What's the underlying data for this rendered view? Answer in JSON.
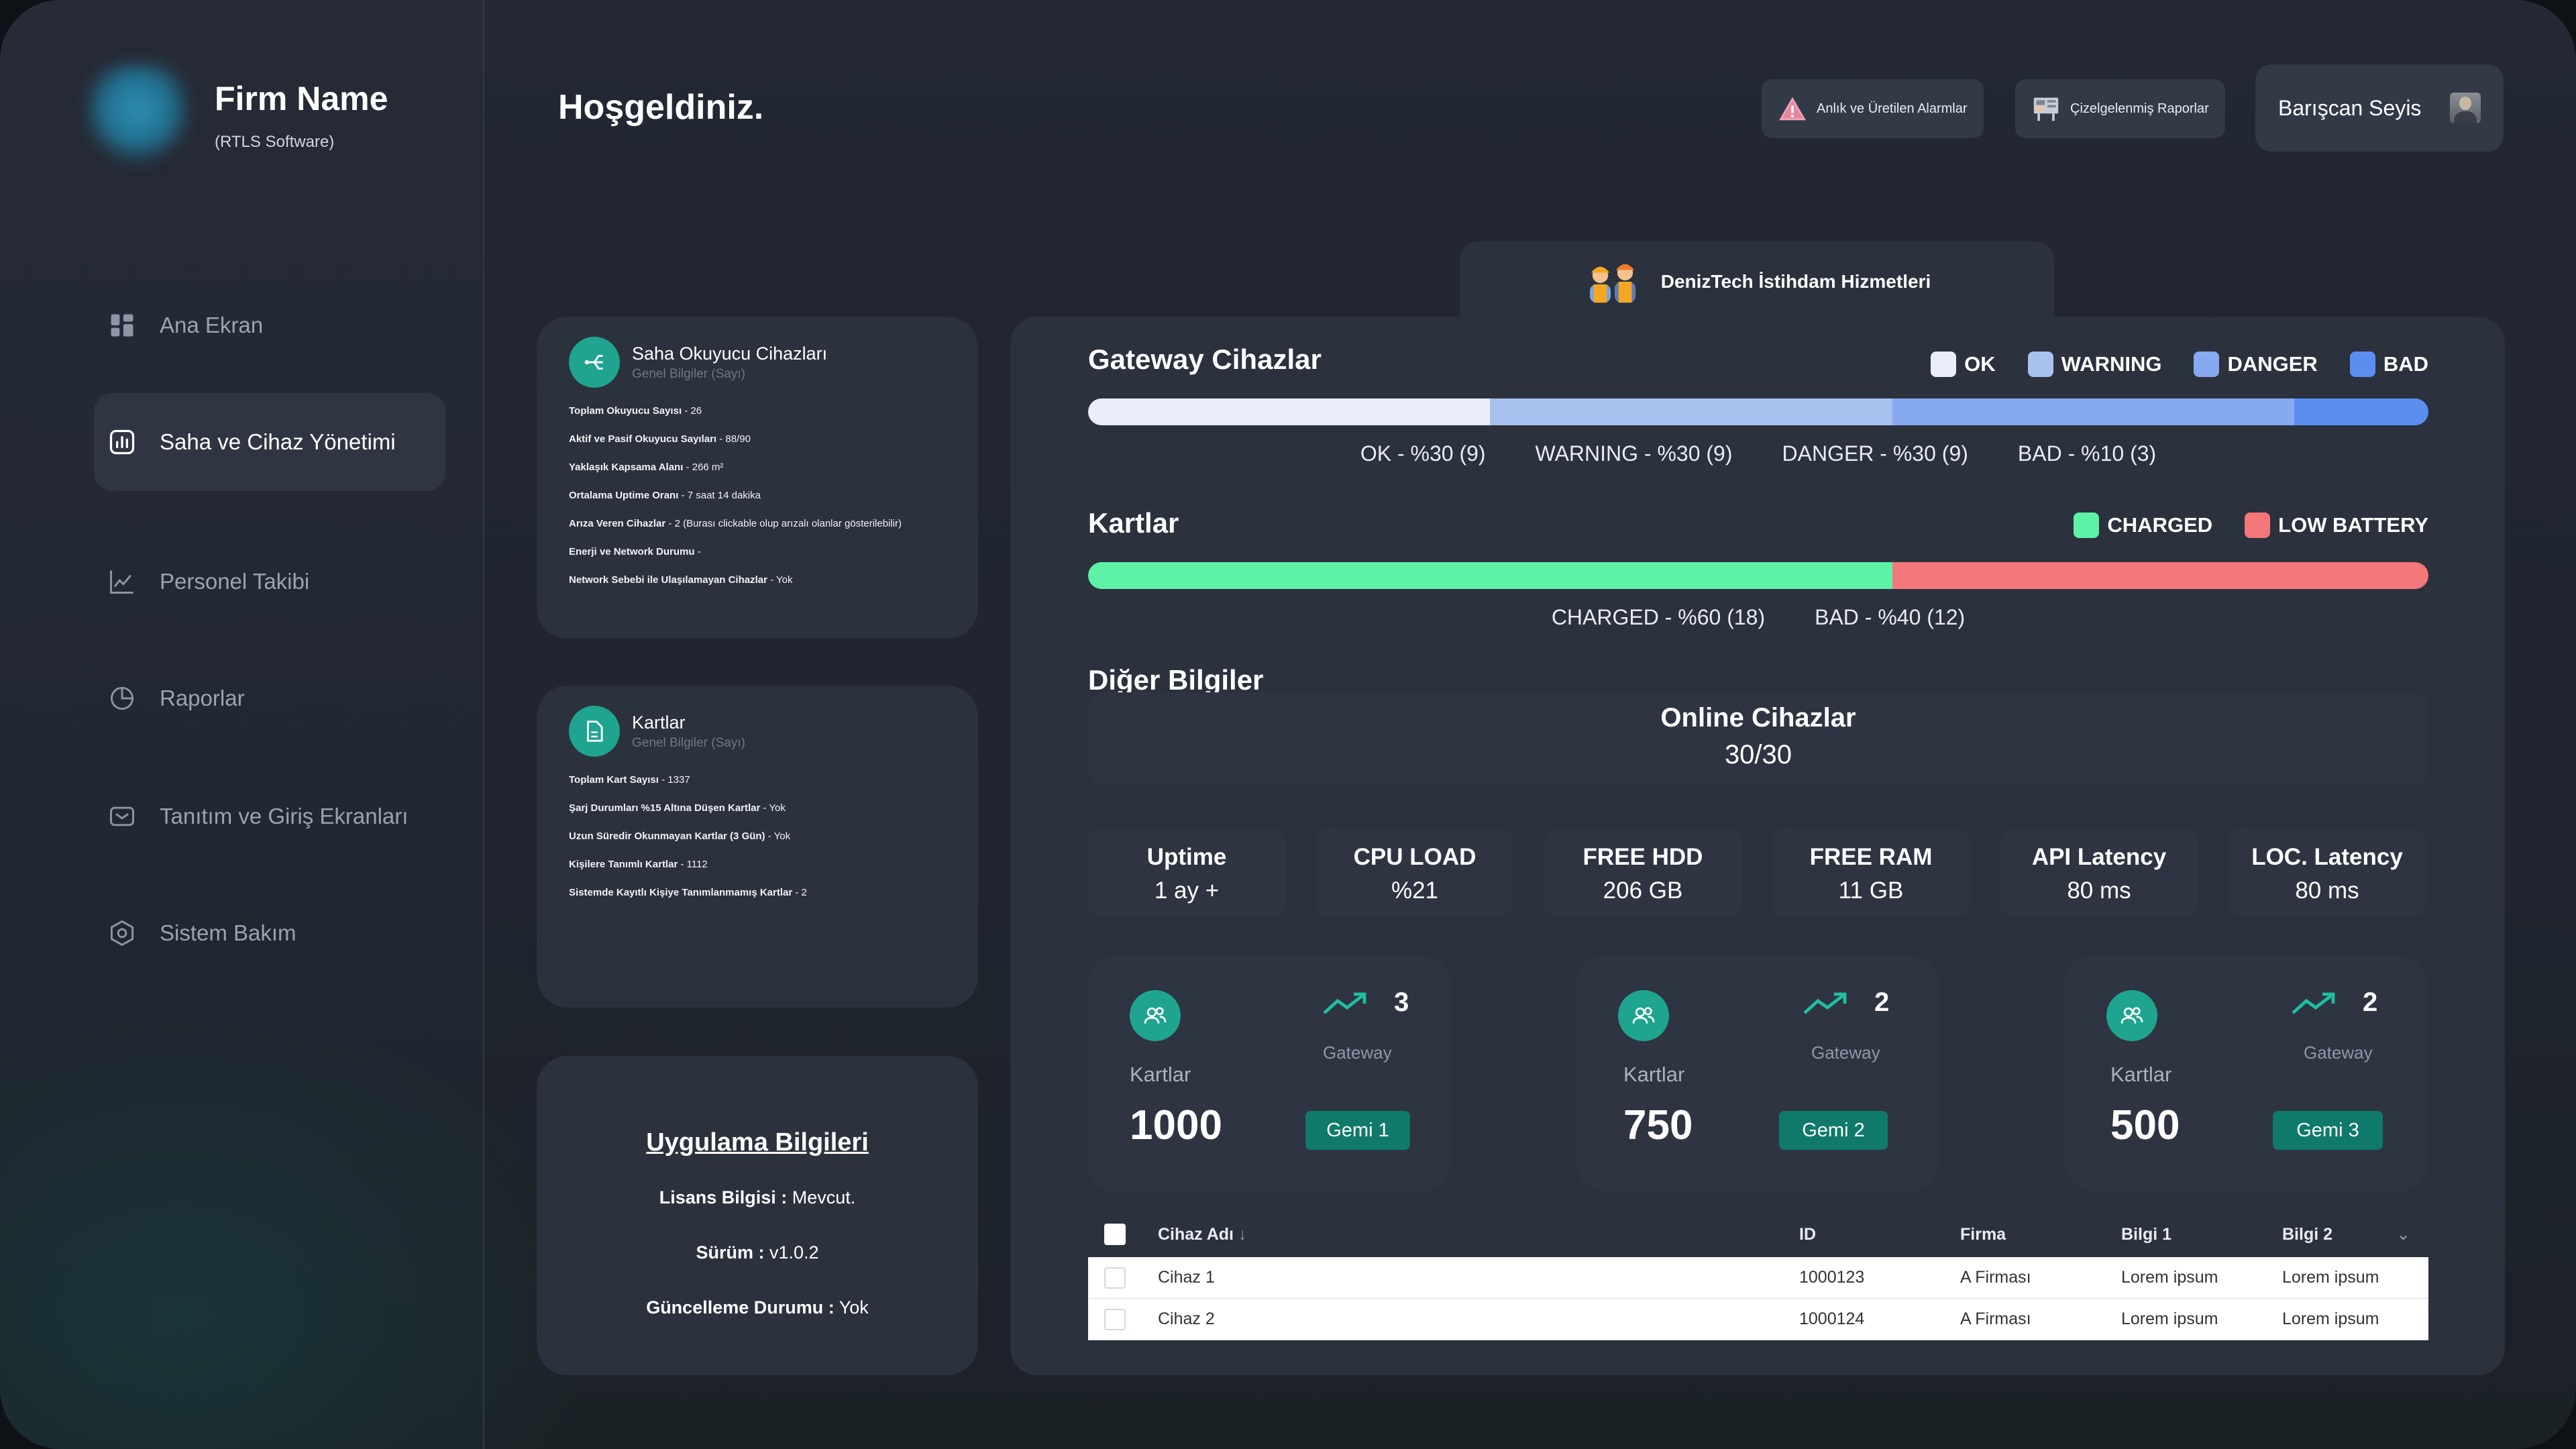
{
  "brand": {
    "firm_name": "Firm Name",
    "subtitle": "(RTLS Software)"
  },
  "sidebar": {
    "items": [
      {
        "label": "Ana Ekran",
        "icon": "dashboard-grid-icon",
        "active": false
      },
      {
        "label": "Saha ve Cihaz Yönetimi",
        "icon": "device-chart-icon",
        "active": true
      },
      {
        "label": "Personel Takibi",
        "icon": "line-chart-icon",
        "active": false
      },
      {
        "label": "Raporlar",
        "icon": "pie-chart-icon",
        "active": false
      },
      {
        "label": "Tanıtım ve Giriş Ekranları",
        "icon": "mail-icon",
        "active": false
      },
      {
        "label": "Sistem Bakım",
        "icon": "settings-hex-icon",
        "active": false
      }
    ]
  },
  "header": {
    "welcome": "Hoşgeldiniz.",
    "alarms_label": "Anlık ve Üretilen Alarmlar",
    "reports_label": "Çizelgelenmiş Raporlar",
    "user_name": "Barışcan Seyis"
  },
  "cards": {
    "readers": {
      "title": "Saha Okuyucu Cihazları",
      "subtitle": "Genel Bilgiler (Sayı)",
      "lines": [
        {
          "k": "Toplam Okuyucu Sayısı",
          "v": " - 26"
        },
        {
          "k": "Aktif ve Pasif Okuyucu Sayıları",
          "v": " - 88/90"
        },
        {
          "k": "Yaklaşık Kapsama Alanı",
          "v": " - 266 m²"
        },
        {
          "k": "Ortalama Uptime Oranı",
          "v": " - 7 saat 14 dakika"
        },
        {
          "k": "Arıza Veren Cihazlar",
          "v": " - 2 (Burası clickable olup arızalı olanlar gösterilebilir)"
        },
        {
          "k": "Enerji ve Network Durumu",
          "v": " -"
        },
        {
          "k": "Network Sebebi ile Ulaşılamayan Cihazlar",
          "v": " - Yok"
        }
      ]
    },
    "cards_info": {
      "title": "Kartlar",
      "subtitle": "Genel Bilgiler (Sayı)",
      "lines": [
        {
          "k": "Toplam Kart Sayısı",
          "v": " - 1337"
        },
        {
          "k": "Şarj Durumları %15 Altına Düşen Kartlar",
          "v": " - Yok"
        },
        {
          "k": "Uzun Süredir Okunmayan Kartlar (3 Gün)",
          "v": " - Yok"
        },
        {
          "k": "Kişilere Tanımlı Kartlar",
          "v": " - 1112"
        },
        {
          "k": "Sistemde Kayıtlı Kişiye Tanımlanmamış Kartlar",
          "v": " - 2"
        }
      ]
    },
    "app_info": {
      "title": "Uygulama Bilgileri",
      "license_k": "Lisans Bilgisi :",
      "license_v": " Mevcut.",
      "version_k": "Sürüm :",
      "version_v": " v1.0.2",
      "update_k": "Güncelleme Durumu :",
      "update_v": " Yok"
    }
  },
  "company": {
    "name": "DenizTech İstihdam Hizmetleri"
  },
  "gateway": {
    "title": "Gateway Cihazlar",
    "legend": [
      {
        "label": "OK",
        "color": "#e9eef8"
      },
      {
        "label": "WARNING",
        "color": "#a9c1ee"
      },
      {
        "label": "DANGER",
        "color": "#86a9f0"
      },
      {
        "label": "BAD",
        "color": "#5a8ff0"
      }
    ],
    "segments": [
      {
        "pct": 30,
        "color": "#e9eef8"
      },
      {
        "pct": 30,
        "color": "#a9c1ee"
      },
      {
        "pct": 30,
        "color": "#86a9f0"
      },
      {
        "pct": 10,
        "color": "#5a8ff0"
      }
    ],
    "labels": [
      "OK - %30 (9)",
      "WARNING - %30 (9)",
      "DANGER - %30 (9)",
      "BAD - %10 (3)"
    ]
  },
  "kartlar": {
    "title": "Kartlar",
    "legend": [
      {
        "label": "CHARGED",
        "color": "#5ef2a6"
      },
      {
        "label": "LOW BATTERY",
        "color": "#f4777a"
      }
    ],
    "segments": [
      {
        "pct": 60,
        "color": "#5ef2a6"
      },
      {
        "pct": 40,
        "color": "#f4777a"
      }
    ],
    "labels": [
      "CHARGED - %60 (18)",
      "BAD - %40 (12)"
    ]
  },
  "other": {
    "title": "Diğer Bilgiler",
    "online_title": "Online Cihazlar",
    "online_value": "30/30",
    "stats": [
      {
        "name": "Uptime",
        "value": "1 ay +"
      },
      {
        "name": "CPU LOAD",
        "value": "%21"
      },
      {
        "name": "FREE HDD",
        "value": "206 GB"
      },
      {
        "name": "FREE RAM",
        "value": "11 GB"
      },
      {
        "name": "API Latency",
        "value": "80 ms"
      },
      {
        "name": "LOC. Latency",
        "value": "80 ms"
      }
    ]
  },
  "ships": [
    {
      "gateway_count": "3",
      "gateway_label": "Gateway",
      "cards_label": "Kartlar",
      "cards_value": "1000",
      "button": "Gemi 1"
    },
    {
      "gateway_count": "2",
      "gateway_label": "Gateway",
      "cards_label": "Kartlar",
      "cards_value": "750",
      "button": "Gemi 2"
    },
    {
      "gateway_count": "2",
      "gateway_label": "Gateway",
      "cards_label": "Kartlar",
      "cards_value": "500",
      "button": "Gemi 3"
    }
  ],
  "table": {
    "headers": {
      "name": "Cihaz Adı",
      "id": "ID",
      "firm": "Firma",
      "info1": "Bilgi 1",
      "info2": "Bilgi 2"
    },
    "rows": [
      {
        "name": "Cihaz 1",
        "id": "1000123",
        "firm": "A Firması",
        "info1": "Lorem ipsum",
        "info2": "Lorem ipsum"
      },
      {
        "name": "Cihaz 2",
        "id": "1000124",
        "firm": "A Firması",
        "info1": "Lorem ipsum",
        "info2": "Lorem ipsum"
      }
    ]
  }
}
